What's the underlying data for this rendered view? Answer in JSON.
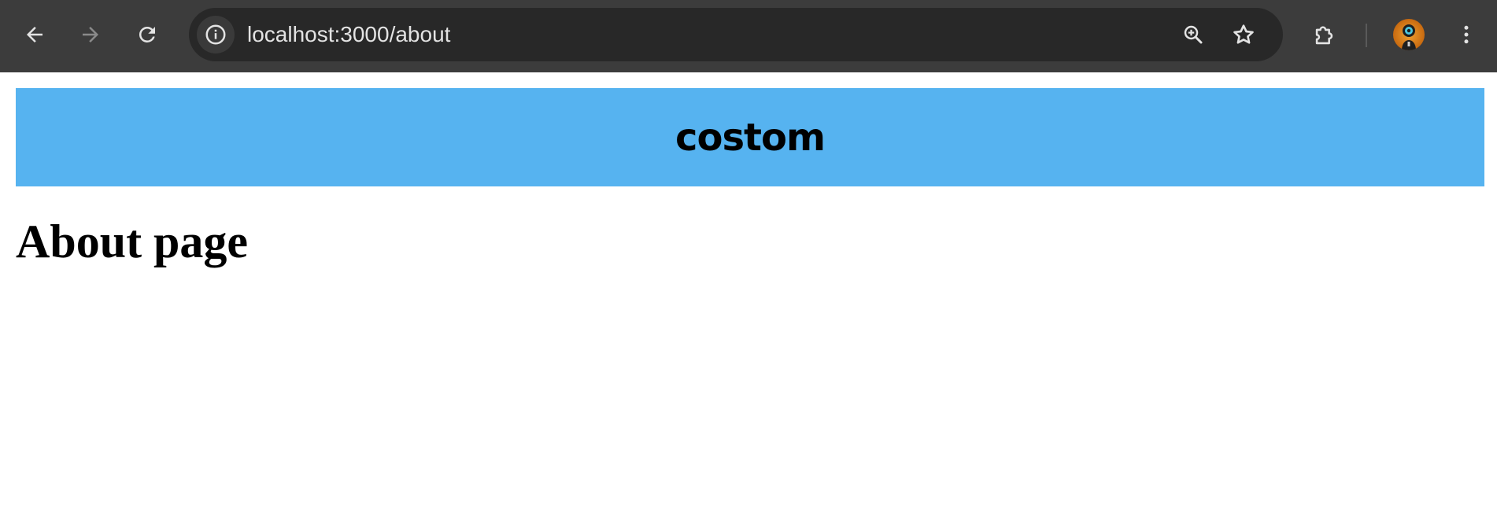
{
  "browser": {
    "url": "localhost:3000/about",
    "icons": {
      "back": "back-arrow-icon",
      "forward": "forward-arrow-icon",
      "reload": "reload-icon",
      "site_info": "info-icon",
      "zoom": "zoom-in-icon",
      "bookmark": "star-icon",
      "extensions": "puzzle-icon",
      "profile": "avatar-icon",
      "menu": "more-vert-icon"
    },
    "colors": {
      "toolbar": "#3c3c3c",
      "omnibox": "#282828",
      "icon": "#e3e3e3",
      "icon_disabled": "#8a8a8a"
    }
  },
  "page": {
    "banner_title": "costom",
    "heading": "About page",
    "colors": {
      "banner_bg": "#56b3f0",
      "text": "#000000",
      "background": "#ffffff"
    }
  }
}
